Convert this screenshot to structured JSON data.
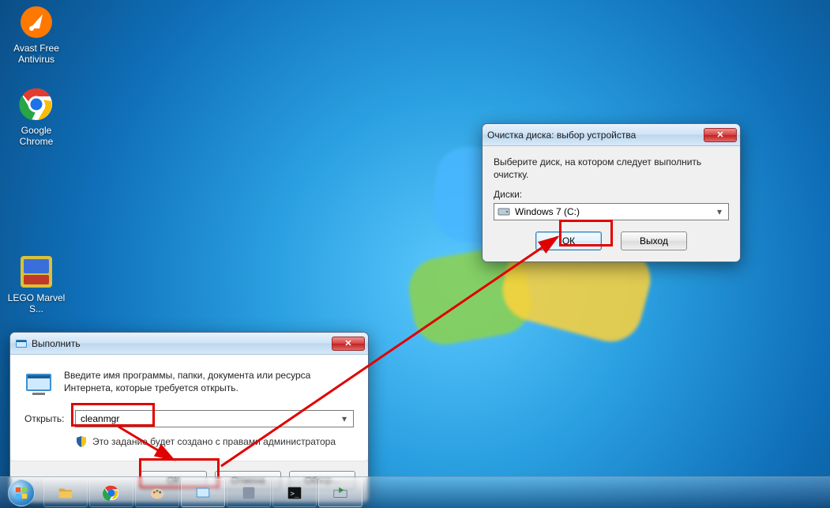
{
  "desktop_icons": {
    "avast": "Avast Free Antivirus",
    "chrome": "Google Chrome",
    "lego": "LEGO Marvel S..."
  },
  "run_dialog": {
    "title": "Выполнить",
    "description": "Введите имя программы, папки, документа или ресурса Интернета, которые требуется открыть.",
    "open_label": "Открыть:",
    "open_value": "cleanmgr",
    "admin_note": "Это задание будет создано с правами администратора",
    "buttons": {
      "ok": "OK",
      "cancel": "Отмена",
      "browse": "Обзор..."
    }
  },
  "cleanup_dialog": {
    "title": "Очистка диска: выбор устройства",
    "message": "Выберите диск, на котором следует выполнить очистку.",
    "drives_label": "Диски:",
    "selected_drive": "Windows 7 (C:)",
    "buttons": {
      "ok": "ОК",
      "exit": "Выход"
    }
  },
  "icons": {
    "close_glyph": "✕"
  }
}
